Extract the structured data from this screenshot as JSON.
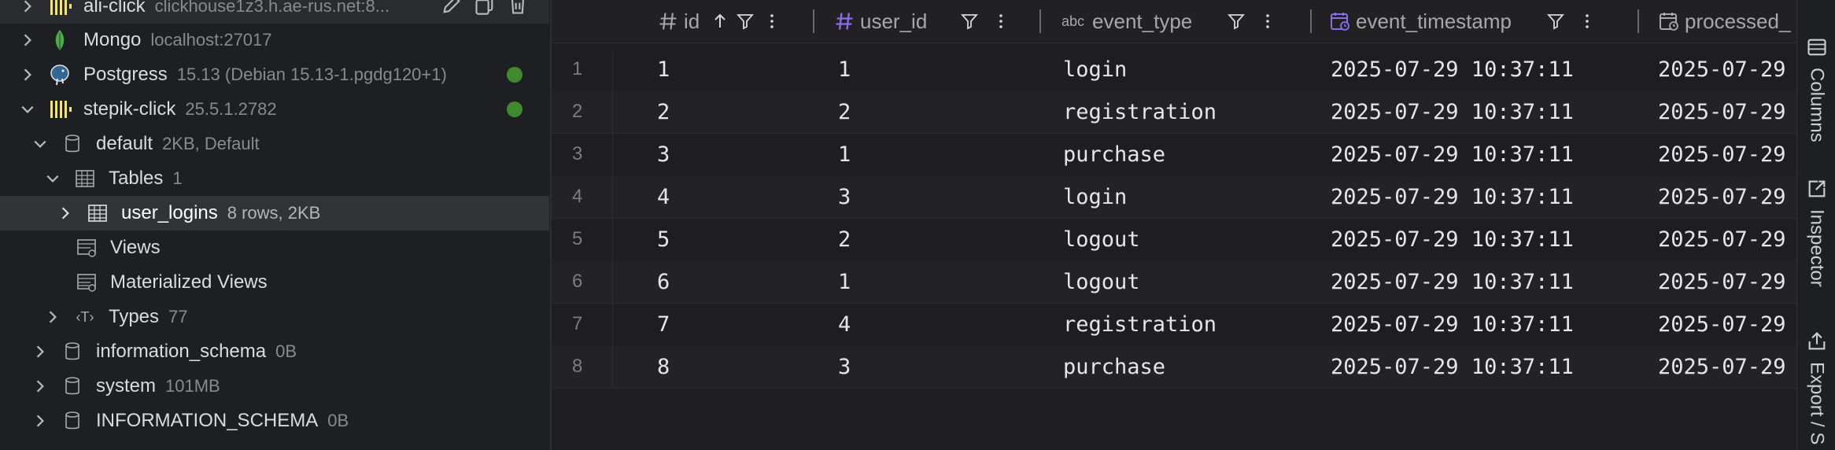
{
  "tree": {
    "rows": [
      {
        "name": "ali-click",
        "meta": "clickhouse1z3.h.ae-rus.net:8..."
      },
      {
        "name": "Mongo",
        "meta": "localhost:27017"
      },
      {
        "name": "Postgress",
        "meta": "15.13 (Debian 15.13-1.pgdg120+1)"
      },
      {
        "name": "stepik-click",
        "meta": "25.5.1.2782"
      },
      {
        "name": "default",
        "meta": "2KB, Default"
      },
      {
        "name": "Tables",
        "meta": "1"
      },
      {
        "name": "user_logins",
        "meta": "8 rows, 2KB"
      },
      {
        "name": "Views",
        "meta": ""
      },
      {
        "name": "Materialized Views",
        "meta": ""
      },
      {
        "name": "Types",
        "meta": "77"
      },
      {
        "name": "information_schema",
        "meta": "0B"
      },
      {
        "name": "system",
        "meta": "101MB"
      },
      {
        "name": "INFORMATION_SCHEMA",
        "meta": "0B"
      }
    ],
    "status_color": "#3f8a2f",
    "types_icon_text": "‹T›",
    "abc_icon_text": "abc"
  },
  "grid": {
    "columns": [
      {
        "name": "id",
        "type_icon": "hash-icon"
      },
      {
        "name": "user_id",
        "type_icon": "hash-icon"
      },
      {
        "name": "event_type",
        "type_icon": "abc-icon"
      },
      {
        "name": "event_timestamp",
        "type_icon": "calendar-clock-icon"
      },
      {
        "name": "processed_",
        "type_icon": "calendar-clock-icon"
      }
    ],
    "rows": [
      {
        "n": "1",
        "id": "1",
        "user_id": "1",
        "event_type": "login",
        "event_timestamp": "2025-07-29 10:37:11",
        "processed": "2025-07-29"
      },
      {
        "n": "2",
        "id": "2",
        "user_id": "2",
        "event_type": "registration",
        "event_timestamp": "2025-07-29 10:37:11",
        "processed": "2025-07-29"
      },
      {
        "n": "3",
        "id": "3",
        "user_id": "1",
        "event_type": "purchase",
        "event_timestamp": "2025-07-29 10:37:11",
        "processed": "2025-07-29"
      },
      {
        "n": "4",
        "id": "4",
        "user_id": "3",
        "event_type": "login",
        "event_timestamp": "2025-07-29 10:37:11",
        "processed": "2025-07-29"
      },
      {
        "n": "5",
        "id": "5",
        "user_id": "2",
        "event_type": "logout",
        "event_timestamp": "2025-07-29 10:37:11",
        "processed": "2025-07-29"
      },
      {
        "n": "6",
        "id": "6",
        "user_id": "1",
        "event_type": "logout",
        "event_timestamp": "2025-07-29 10:37:11",
        "processed": "2025-07-29"
      },
      {
        "n": "7",
        "id": "7",
        "user_id": "4",
        "event_type": "registration",
        "event_timestamp": "2025-07-29 10:37:11",
        "processed": "2025-07-29"
      },
      {
        "n": "8",
        "id": "8",
        "user_id": "3",
        "event_type": "purchase",
        "event_timestamp": "2025-07-29 10:37:11",
        "processed": "2025-07-29"
      }
    ]
  },
  "sidebar": {
    "tabs": [
      "Columns",
      "Inspector",
      "Export / S"
    ]
  },
  "colors": {
    "accent_purple": "#8b6cf0",
    "clickhouse_yellow": "#f5e66a",
    "mongo_green": "#4fa94d",
    "postgres_blue": "#336791"
  }
}
